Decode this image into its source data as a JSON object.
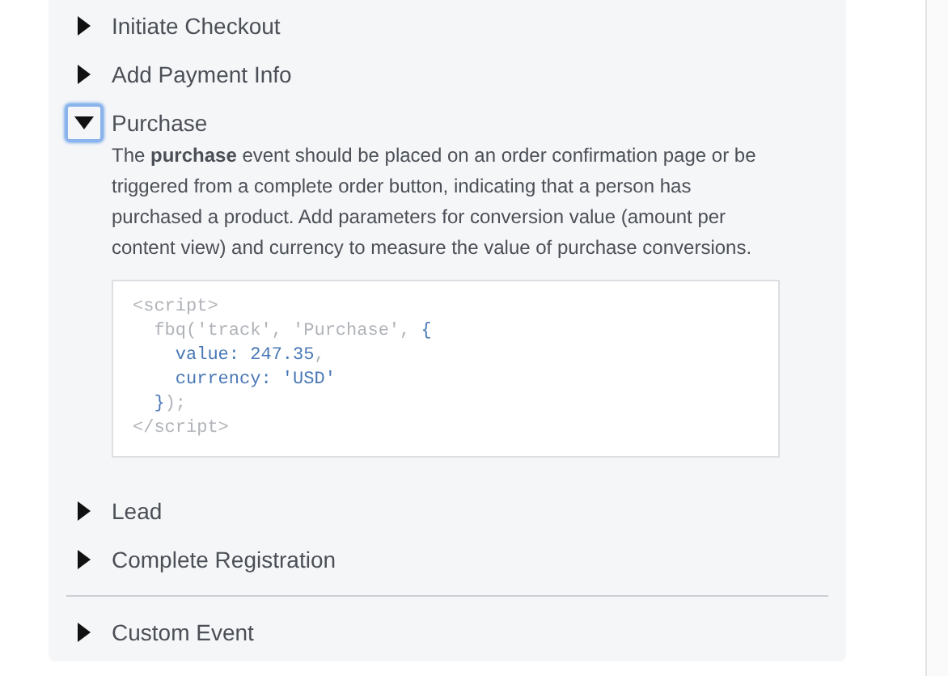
{
  "events": [
    {
      "label": "Initiate Checkout",
      "expanded": false,
      "focused": false,
      "divider_before": false
    },
    {
      "label": "Add Payment Info",
      "expanded": false,
      "focused": false,
      "divider_before": false
    },
    {
      "label": "Purchase",
      "expanded": true,
      "focused": true,
      "divider_before": false,
      "description": "The **purchase** event should be placed on an order confirmation page or be triggered from a complete order button, indicating that a person has purchased a product. Add parameters for conversion value (amount per content view) and currency to measure the value of purchase conversions.",
      "code": [
        [
          {
            "kind": "muted",
            "text": "<script>"
          }
        ],
        [
          {
            "kind": "muted",
            "text": "  fbq('track', 'Purchase', "
          },
          {
            "kind": "accent",
            "text": "{"
          }
        ],
        [
          {
            "kind": "accent",
            "text": "    value: 247.35"
          },
          {
            "kind": "muted",
            "text": ","
          }
        ],
        [
          {
            "kind": "accent",
            "text": "    currency: 'USD'"
          }
        ],
        [
          {
            "kind": "accent",
            "text": "  }"
          },
          {
            "kind": "muted",
            "text": ");"
          }
        ],
        [
          {
            "kind": "muted",
            "text": "</script>"
          }
        ]
      ]
    },
    {
      "label": "Lead",
      "expanded": false,
      "focused": false,
      "divider_before": false
    },
    {
      "label": "Complete Registration",
      "expanded": false,
      "focused": false,
      "divider_before": false
    },
    {
      "label": "Custom Event",
      "expanded": false,
      "focused": false,
      "divider_before": true
    }
  ]
}
